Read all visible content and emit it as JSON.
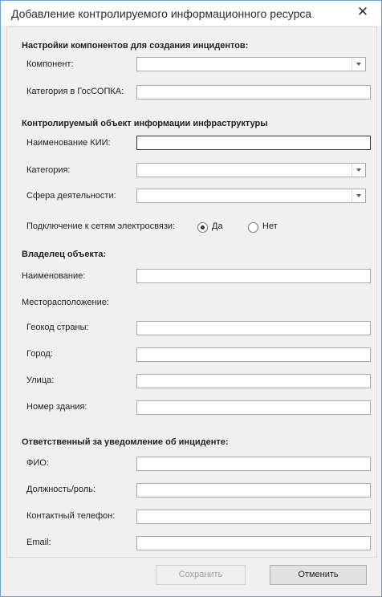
{
  "window": {
    "title": "Добавление контролируемого информационного ресурса",
    "close_glyph": "✕"
  },
  "components": {
    "header": "Настройки компонентов для создания инцидентов:",
    "component_label": "Компонент:",
    "component_value": "",
    "gossopka_label": "Категория в ГосСОПКА:",
    "gossopka_value": ""
  },
  "kii": {
    "header": "Контролируемый объект информации инфраструктуры",
    "name_label": "Наименование КИИ:",
    "name_value": "",
    "category_label": "Категория:",
    "category_value": "",
    "sphere_label": "Сфера деятельности:",
    "sphere_value": "",
    "network_label": "Подключение к сетям электросвязи:",
    "yes_label": "Да",
    "no_label": "Нет",
    "network_selected": "Да"
  },
  "owner": {
    "header": "Владелец объекта:",
    "name_label": "Наименование:",
    "name_value": "",
    "location_label": "Месторасположение:",
    "geocode_label": "Геокод страны:",
    "geocode_value": "",
    "city_label": "Город:",
    "city_value": "",
    "street_label": "Улица:",
    "street_value": "",
    "building_label": "Номер здания:",
    "building_value": ""
  },
  "responsible": {
    "header": "Ответственный за уведомление об инциденте:",
    "fio_label": "ФИО:",
    "fio_value": "",
    "role_label": "Должность/роль:",
    "role_value": "",
    "phone_label": "Контактный телефон:",
    "phone_value": "",
    "email_label": "Email:",
    "email_value": ""
  },
  "buttons": {
    "save_label": "Сохранить",
    "save_enabled": false,
    "cancel_label": "Отменить"
  }
}
